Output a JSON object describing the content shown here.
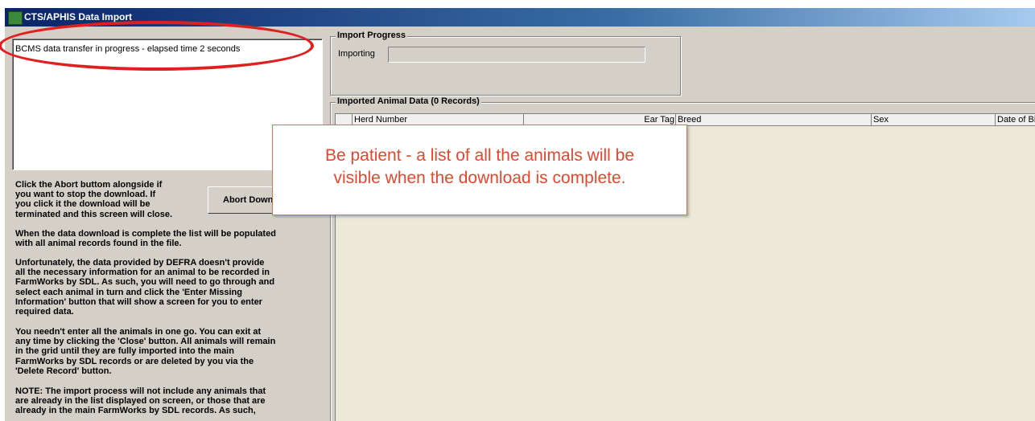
{
  "window": {
    "title": "CTS/APHIS Data Import"
  },
  "status": {
    "text": "BCMS data transfer in progress - elapsed time 2 seconds"
  },
  "help": {
    "abort_instructions": [
      "Click the Abort buttom alongside if",
      "you want to stop the download. If",
      "you click it the download will be",
      "terminated and this screen will close."
    ],
    "paragraph2": [
      "When the data download is complete the list will be populated",
      "with all animal records found in the file."
    ],
    "paragraph3": [
      "Unfortunately, the data provided by DEFRA doesn't provide",
      "all the necessary information for an animal to be recorded in",
      "FarmWorks by SDL. As such, you will need to go through and",
      "select each animal in turn and click the 'Enter Missing",
      "Information' button that will show a screen for you to enter",
      "required data."
    ],
    "paragraph4": [
      "You needn't enter all the animals in one go. You can exit at",
      "any time by clicking the 'Close' button. All animals will remain",
      "in the grid until they are fully imported into the main",
      "FarmWorks by SDL records or are deleted by you via the",
      "'Delete Record' button."
    ],
    "paragraph5": [
      "NOTE: The import process will not include any animals that",
      "are already in the list displayed on screen, or those that are",
      "already in the main FarmWorks by SDL records. As such,"
    ]
  },
  "abort_button": {
    "label": "Abort Download"
  },
  "import_progress": {
    "label": "Import Progress",
    "field_label": "Importing"
  },
  "animal_data": {
    "label": "Imported Animal Data (0 Records)",
    "columns": [
      "Herd Number",
      "Ear Tag",
      "Breed",
      "Sex",
      "Date of Birth"
    ]
  },
  "callout": {
    "lines": [
      "Be patient - a list of all the animals will be",
      "visible when the download is complete."
    ]
  }
}
